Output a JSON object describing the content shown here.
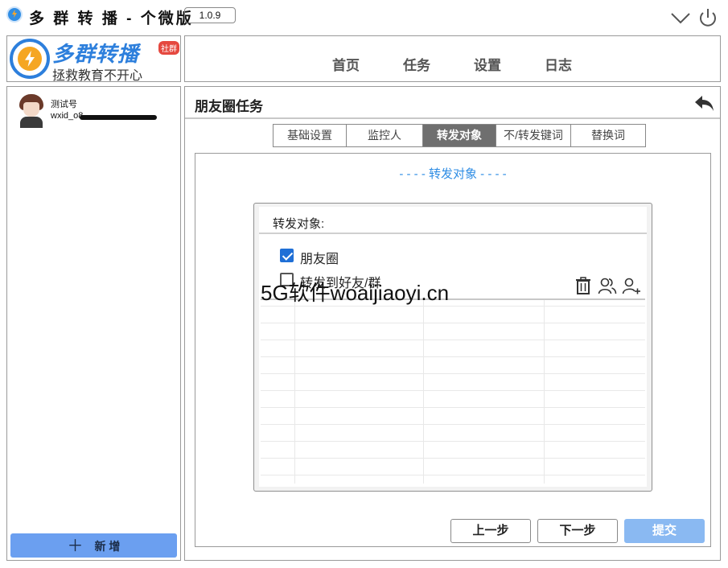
{
  "app": {
    "title": "多 群 转 播 - 个微版",
    "version": "1.0.9"
  },
  "logo": {
    "brand": "多群转播",
    "badge": "社群",
    "slogan": "拯救教育不开心"
  },
  "nav": {
    "items": [
      "首页",
      "任务",
      "设置",
      "日志"
    ]
  },
  "sidebar": {
    "account": {
      "name": "测试号",
      "wxid": "wxid_o8"
    },
    "add_label": "新 增"
  },
  "main": {
    "title": "朋友圈任务",
    "tabs": [
      "基础设置",
      "监控人",
      "转发对象",
      "不/转发键词",
      "替换词"
    ],
    "active_tab": "转发对象",
    "section_heading": "- - - - 转发对象 - - - -",
    "card_label": "转发对象:",
    "options": [
      {
        "label": "朋友圈",
        "checked": true
      },
      {
        "label": "转发到好友/群",
        "checked": false
      }
    ],
    "tools": [
      "trash-icon",
      "group-icon",
      "add-user-icon"
    ],
    "buttons": {
      "prev": "上一步",
      "next": "下一步",
      "submit": "提交"
    }
  },
  "watermark": "5G软件woaijiaoyi.cn",
  "colors": {
    "accent": "#2f8de4",
    "brand": "#2d7fdc",
    "add_button": "#6b9ff0",
    "submit_button": "#8ab9f2",
    "active_tab": "#6f6f6f"
  }
}
